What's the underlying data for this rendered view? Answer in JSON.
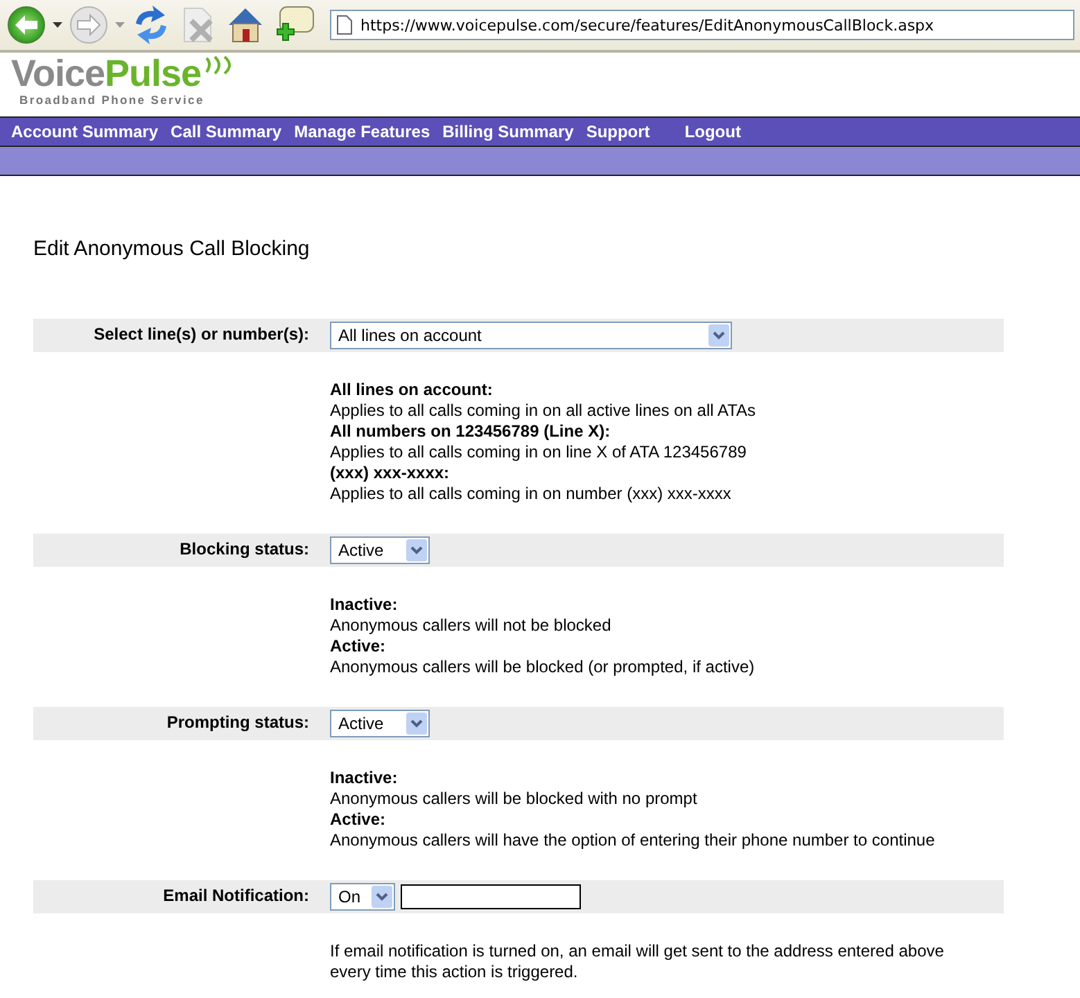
{
  "browser": {
    "url": "https://www.voicepulse.com/secure/features/EditAnonymousCallBlock.aspx"
  },
  "logo": {
    "name_first": "Voice",
    "name_second": "Pulse",
    "tagline": "Broadband Phone Service"
  },
  "nav": [
    {
      "label": "Account Summary"
    },
    {
      "label": "Call Summary"
    },
    {
      "label": "Manage Features"
    },
    {
      "label": "Billing Summary"
    },
    {
      "label": "Support"
    },
    {
      "label": "Logout"
    }
  ],
  "page_title": "Edit Anonymous Call Blocking",
  "fields": [
    {
      "kind": "wide-select",
      "label": "Select line(s) or number(s):",
      "value": "All lines on account",
      "help": [
        {
          "kind": "term",
          "text": "All lines on account:"
        },
        {
          "kind": "desc",
          "text": "Applies to all calls coming in on all active lines on all ATAs"
        },
        {
          "kind": "term",
          "text": "All numbers on 123456789 (Line X):"
        },
        {
          "kind": "desc",
          "text": "Applies to all calls coming in on line X of ATA 123456789"
        },
        {
          "kind": "term",
          "text": "(xxx) xxx-xxxx:"
        },
        {
          "kind": "desc",
          "text": "Applies to all calls coming in on number (xxx) xxx-xxxx"
        }
      ]
    },
    {
      "kind": "select",
      "label": "Blocking status:",
      "value": "Active",
      "help": [
        {
          "kind": "term",
          "text": "Inactive:"
        },
        {
          "kind": "desc",
          "text": "Anonymous callers will not be blocked"
        },
        {
          "kind": "term",
          "text": "Active:"
        },
        {
          "kind": "desc",
          "text": "Anonymous callers will be blocked (or prompted, if active)"
        }
      ]
    },
    {
      "kind": "select",
      "label": "Prompting status:",
      "value": "Active",
      "help": [
        {
          "kind": "term",
          "text": "Inactive:"
        },
        {
          "kind": "desc",
          "text": "Anonymous callers will be blocked with no prompt"
        },
        {
          "kind": "term",
          "text": "Active:"
        },
        {
          "kind": "desc",
          "text": "Anonymous callers will have the option of entering their phone number to continue"
        }
      ]
    },
    {
      "kind": "select-email",
      "label": "Email Notification:",
      "value": "On",
      "help": [
        {
          "kind": "para",
          "text": "If email notification is turned on, an email will get sent to the address entered above every time this action is triggered."
        }
      ]
    }
  ]
}
